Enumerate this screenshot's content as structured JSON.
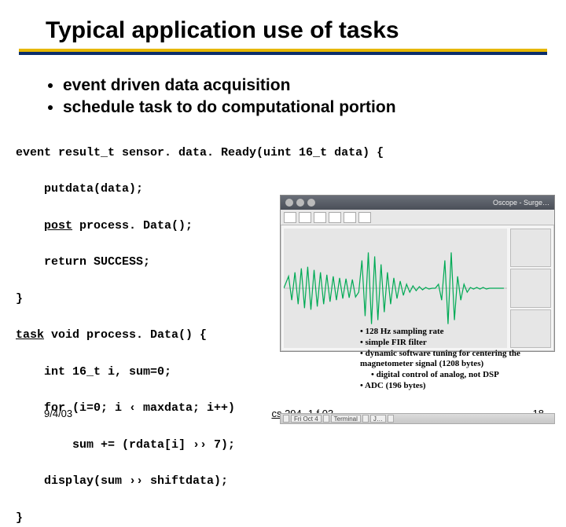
{
  "title": "Typical application use of tasks",
  "bullets": [
    "event driven data acquisition",
    "schedule task to do computational portion"
  ],
  "code": {
    "l1a": "event result_t sensor. data. Ready(uint 16_t data) {",
    "l2": "putdata(data);",
    "l3_kw": "post",
    "l3_rest": " process. Data();",
    "l4": "return SUCCESS;",
    "l5": "}",
    "l6_kw": "task",
    "l6_rest": " void process. Data() {",
    "l7": "int 16_t i, sum=0;",
    "l8": "for (i=0; i ‹ maxdata; i++)",
    "l9": "sum += (rdata[i] ›› 7);",
    "l10": "display(sum ›› shiftdata);",
    "l11": "}"
  },
  "oscope": {
    "winlabel": "Oscope - Surge…"
  },
  "annotations": {
    "a1": "• 128 Hz sampling rate",
    "a2": "• simple FIR filter",
    "a3": "• dynamic software tuning for centering the magnetometer signal (1208 bytes)",
    "a4": "• digital control of analog, not DSP",
    "a5": "• ADC (196 bytes)"
  },
  "footer": {
    "date": "9/4/03",
    "mid": "cs 294 -1 f 03",
    "page": "18"
  },
  "taskbar": {
    "items": [
      "",
      "Fri Oct 4",
      "",
      "Terminal",
      "",
      "J…",
      ""
    ]
  }
}
